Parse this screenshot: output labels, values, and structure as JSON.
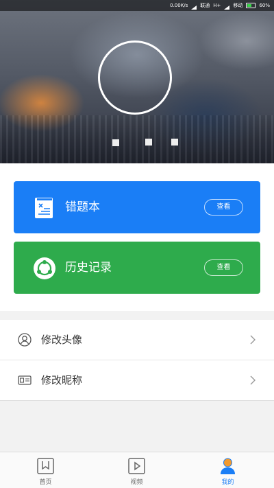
{
  "status_bar": {
    "speed": "0.00K/s",
    "carrier1": "联通",
    "network": "H+",
    "carrier2": "移动",
    "battery": "60%"
  },
  "header": {
    "avatar_icon": "avatar-placeholder-ring",
    "nickname_masked": true
  },
  "cards": [
    {
      "title": "错题本",
      "button": "查看",
      "icon": "notebook-icon",
      "color": "#1a7ef6"
    },
    {
      "title": "历史记录",
      "button": "查看",
      "icon": "history-circle-icon",
      "color": "#2eab4c"
    }
  ],
  "settings": [
    {
      "label": "修改头像",
      "icon": "user-icon"
    },
    {
      "label": "修改昵称",
      "icon": "id-card-icon"
    }
  ],
  "tabs": [
    {
      "label": "首页",
      "icon": "home-bookmark-icon",
      "active": false
    },
    {
      "label": "视频",
      "icon": "video-play-icon",
      "active": false
    },
    {
      "label": "我的",
      "icon": "profile-icon",
      "active": true
    }
  ],
  "accent_color": "#1a7ef6"
}
